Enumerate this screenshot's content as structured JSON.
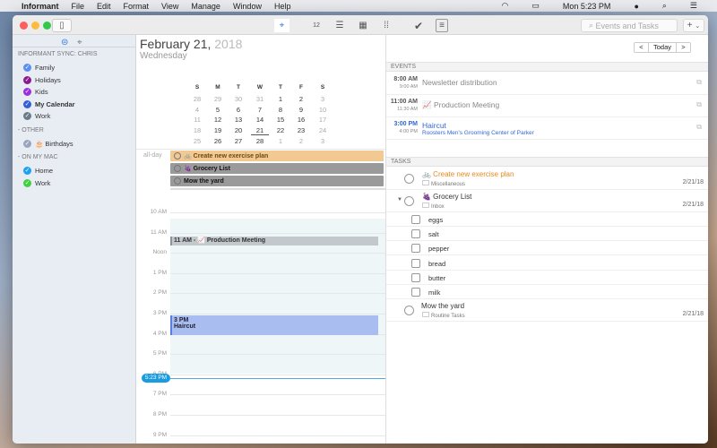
{
  "menubar": {
    "apple": "",
    "app": "Informant",
    "items": [
      "File",
      "Edit",
      "Format",
      "View",
      "Manage",
      "Window",
      "Help"
    ],
    "clock": "Mon 5:23 PM"
  },
  "toolbar": {
    "search_placeholder": "Events and Tasks",
    "add": "+",
    "add_menu": "⌄",
    "day_icon_text": "12"
  },
  "sidebar": {
    "groups": [
      {
        "title": "INFORMANT SYNC: CHRIS",
        "items": [
          {
            "label": "Family",
            "color": "#5b8ef0"
          },
          {
            "label": "Holidays",
            "color": "#8b1a8f"
          },
          {
            "label": "Kids",
            "color": "#9b2fe0"
          },
          {
            "label": "My Calendar",
            "color": "#3360d8",
            "bold": true
          },
          {
            "label": "Work",
            "color": "#6d7a8c"
          }
        ]
      },
      {
        "title": " - OTHER",
        "items": [
          {
            "label": "🎂 Birthdays",
            "color": "#98a6bd"
          }
        ]
      },
      {
        "title": " - ON MY MAC",
        "items": [
          {
            "label": "Home",
            "color": "#1da1f2"
          },
          {
            "label": "Work",
            "color": "#3fd13f"
          }
        ]
      }
    ]
  },
  "header": {
    "date": "February 21, ",
    "year": "2018",
    "weekday": "Wednesday",
    "prev": "<",
    "today": "Today",
    "next": ">"
  },
  "minical": {
    "days": [
      "S",
      "M",
      "T",
      "W",
      "T",
      "F",
      "S"
    ],
    "weeks": [
      [
        "28",
        "29",
        "30",
        "31",
        "1",
        "2",
        "3"
      ],
      [
        "4",
        "5",
        "6",
        "7",
        "8",
        "9",
        "10"
      ],
      [
        "11",
        "12",
        "13",
        "14",
        "15",
        "16",
        "17"
      ],
      [
        "18",
        "19",
        "20",
        "21",
        "22",
        "23",
        "24"
      ],
      [
        "25",
        "26",
        "27",
        "28",
        "1",
        "2",
        "3"
      ]
    ]
  },
  "dayview": {
    "allday_label": "all-day",
    "allday": [
      {
        "label": "🚲 Create new exercise plan",
        "color": "#f2c992"
      },
      {
        "label": "🍇 Grocery List",
        "color": "#9a9a9a"
      },
      {
        "label": "Mow the yard",
        "color": "#9a9a9a"
      }
    ],
    "hours": [
      "10 AM",
      "11 AM",
      "Noon",
      "1 PM",
      "2 PM",
      "3 PM",
      "4 PM",
      "5 PM",
      "6 PM",
      "7 PM",
      "8 PM",
      "9 PM"
    ],
    "events": [
      {
        "label": "11 AM - 📈 Production Meeting"
      },
      {
        "time": "3 PM",
        "label": "Haircut"
      }
    ],
    "now": "5:23 PM"
  },
  "events": {
    "header": "EVENTS",
    "items": [
      {
        "start": "8:00 AM",
        "end": "9:00 AM",
        "title": "Newsletter distribution"
      },
      {
        "start": "11:00 AM",
        "end": "11:30 AM",
        "title": "📈 Production Meeting"
      },
      {
        "start": "3:00 PM",
        "end": "4:00 PM",
        "title": "Haircut",
        "location": "Roosters Men's Grooming Center of Parker"
      }
    ]
  },
  "tasks": {
    "header": "TASKS",
    "items": [
      {
        "title": "🚲 Create new exercise plan",
        "list": "Miscellaneous",
        "date": "2/21/18"
      },
      {
        "title": "🍇 Grocery List",
        "list": "Inbox",
        "date": "2/21/18",
        "subtasks": [
          "eggs",
          "salt",
          "pepper",
          "bread",
          "butter",
          "milk"
        ]
      },
      {
        "title": "Mow the yard",
        "list": "Routine Tasks",
        "date": "2/21/18"
      }
    ]
  }
}
